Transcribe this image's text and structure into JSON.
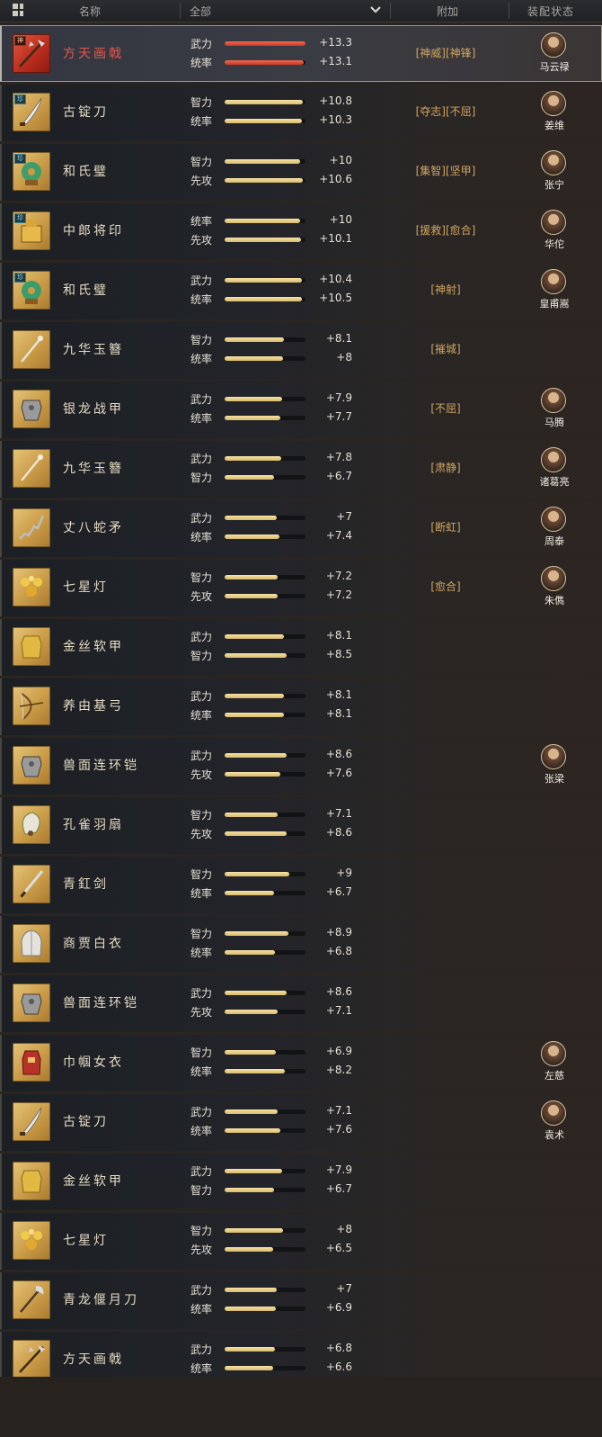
{
  "header": {
    "col_name": "名称",
    "filter_value": "全部",
    "col_extra": "附加",
    "col_status": "装配状态",
    "icons": [
      "grid-view-icon",
      "chevron-down-icon"
    ]
  },
  "colors": {
    "bar_fill": "#e6cb83",
    "bar_fill_selected": "#dc4a33",
    "tag_text": "#d2a560",
    "name_selected": "#e8574a"
  },
  "rows": [
    {
      "name": "方天画戟",
      "icon": "halberd-icon",
      "tier_badge": "神",
      "selected": true,
      "s1": {
        "label": "武力",
        "value": "+13.3",
        "fill": 1.0
      },
      "s2": {
        "label": "统率",
        "value": "+13.1",
        "fill": 0.98
      },
      "extra": "[神威][神锋]",
      "officer": "马云禄"
    },
    {
      "name": "古锭刀",
      "icon": "blade-icon",
      "tier_badge": "珍",
      "s1": {
        "label": "智力",
        "value": "+10.8",
        "fill": 0.97
      },
      "s2": {
        "label": "统率",
        "value": "+10.3",
        "fill": 0.96
      },
      "extra": "[夺志][不屈]",
      "officer": "姜维"
    },
    {
      "name": "和氏璧",
      "icon": "jade-disc-icon",
      "tier_badge": "珍",
      "s1": {
        "label": "智力",
        "value": "+10",
        "fill": 0.93
      },
      "s2": {
        "label": "先攻",
        "value": "+10.6",
        "fill": 0.97
      },
      "extra": "[集智][坚甲]",
      "officer": "张宁"
    },
    {
      "name": "中郎将印",
      "icon": "seal-icon",
      "tier_badge": "珍",
      "s1": {
        "label": "统率",
        "value": "+10",
        "fill": 0.93
      },
      "s2": {
        "label": "先攻",
        "value": "+10.1",
        "fill": 0.94
      },
      "extra": "[援救][愈合]",
      "officer": "华佗"
    },
    {
      "name": "和氏璧",
      "icon": "jade-disc-icon",
      "tier_badge": "珍",
      "s1": {
        "label": "武力",
        "value": "+10.4",
        "fill": 0.95
      },
      "s2": {
        "label": "统率",
        "value": "+10.5",
        "fill": 0.96
      },
      "extra": "[神射]",
      "officer": "皇甫嵩"
    },
    {
      "name": "九华玉簪",
      "icon": "hairpin-icon",
      "s1": {
        "label": "智力",
        "value": "+8.1",
        "fill": 0.73
      },
      "s2": {
        "label": "统率",
        "value": "+8",
        "fill": 0.72
      },
      "extra": "[摧城]",
      "officer": ""
    },
    {
      "name": "银龙战甲",
      "icon": "armor-icon",
      "s1": {
        "label": "武力",
        "value": "+7.9",
        "fill": 0.71
      },
      "s2": {
        "label": "统率",
        "value": "+7.7",
        "fill": 0.69
      },
      "extra": "[不屈]",
      "officer": "马腾"
    },
    {
      "name": "九华玉簪",
      "icon": "hairpin-icon",
      "s1": {
        "label": "武力",
        "value": "+7.8",
        "fill": 0.7
      },
      "s2": {
        "label": "智力",
        "value": "+6.7",
        "fill": 0.61
      },
      "extra": "[肃静]",
      "officer": "诸葛亮"
    },
    {
      "name": "丈八蛇矛",
      "icon": "spear-icon",
      "s1": {
        "label": "武力",
        "value": "+7",
        "fill": 0.64
      },
      "s2": {
        "label": "统率",
        "value": "+7.4",
        "fill": 0.68
      },
      "extra": "[断虹]",
      "officer": "周泰"
    },
    {
      "name": "七星灯",
      "icon": "lamp-icon",
      "s1": {
        "label": "智力",
        "value": "+7.2",
        "fill": 0.66
      },
      "s2": {
        "label": "先攻",
        "value": "+7.2",
        "fill": 0.66
      },
      "extra": "[愈合]",
      "officer": "朱儁"
    },
    {
      "name": "金丝软甲",
      "icon": "vest-icon",
      "s1": {
        "label": "武力",
        "value": "+8.1",
        "fill": 0.73
      },
      "s2": {
        "label": "智力",
        "value": "+8.5",
        "fill": 0.77
      },
      "extra": "",
      "officer": ""
    },
    {
      "name": "养由基弓",
      "icon": "bow-icon",
      "s1": {
        "label": "武力",
        "value": "+8.1",
        "fill": 0.73
      },
      "s2": {
        "label": "统率",
        "value": "+8.1",
        "fill": 0.73
      },
      "extra": "",
      "officer": ""
    },
    {
      "name": "兽面连环铠",
      "icon": "armor-icon",
      "s1": {
        "label": "武力",
        "value": "+8.6",
        "fill": 0.77
      },
      "s2": {
        "label": "先攻",
        "value": "+7.6",
        "fill": 0.69
      },
      "extra": "",
      "officer": "张梁"
    },
    {
      "name": "孔雀羽扇",
      "icon": "fan-icon",
      "s1": {
        "label": "智力",
        "value": "+7.1",
        "fill": 0.65
      },
      "s2": {
        "label": "先攻",
        "value": "+8.6",
        "fill": 0.77
      },
      "extra": "",
      "officer": ""
    },
    {
      "name": "青釭剑",
      "icon": "sword-icon",
      "s1": {
        "label": "智力",
        "value": "+9",
        "fill": 0.8
      },
      "s2": {
        "label": "统率",
        "value": "+6.7",
        "fill": 0.61
      },
      "extra": "",
      "officer": ""
    },
    {
      "name": "商贾白衣",
      "icon": "robe-icon",
      "s1": {
        "label": "智力",
        "value": "+8.9",
        "fill": 0.79
      },
      "s2": {
        "label": "统率",
        "value": "+6.8",
        "fill": 0.62
      },
      "extra": "",
      "officer": ""
    },
    {
      "name": "兽面连环铠",
      "icon": "armor-icon",
      "s1": {
        "label": "武力",
        "value": "+8.6",
        "fill": 0.77
      },
      "s2": {
        "label": "先攻",
        "value": "+7.1",
        "fill": 0.65
      },
      "extra": "",
      "officer": ""
    },
    {
      "name": "巾帼女衣",
      "icon": "dress-icon",
      "s1": {
        "label": "智力",
        "value": "+6.9",
        "fill": 0.63
      },
      "s2": {
        "label": "统率",
        "value": "+8.2",
        "fill": 0.74
      },
      "extra": "",
      "officer": "左慈"
    },
    {
      "name": "古锭刀",
      "icon": "blade-icon",
      "s1": {
        "label": "武力",
        "value": "+7.1",
        "fill": 0.65
      },
      "s2": {
        "label": "统率",
        "value": "+7.6",
        "fill": 0.69
      },
      "extra": "",
      "officer": "袁术"
    },
    {
      "name": "金丝软甲",
      "icon": "vest-icon",
      "s1": {
        "label": "武力",
        "value": "+7.9",
        "fill": 0.71
      },
      "s2": {
        "label": "智力",
        "value": "+6.7",
        "fill": 0.61
      },
      "extra": "",
      "officer": ""
    },
    {
      "name": "七星灯",
      "icon": "lamp-icon",
      "s1": {
        "label": "智力",
        "value": "+8",
        "fill": 0.72
      },
      "s2": {
        "label": "先攻",
        "value": "+6.5",
        "fill": 0.6
      },
      "extra": "",
      "officer": ""
    },
    {
      "name": "青龙偃月刀",
      "icon": "glaive-icon",
      "s1": {
        "label": "武力",
        "value": "+7",
        "fill": 0.64
      },
      "s2": {
        "label": "统率",
        "value": "+6.9",
        "fill": 0.63
      },
      "extra": "",
      "officer": ""
    },
    {
      "name": "方天画戟",
      "icon": "halberd-icon",
      "s1": {
        "label": "武力",
        "value": "+6.8",
        "fill": 0.62
      },
      "s2": {
        "label": "统率",
        "value": "+6.6",
        "fill": 0.6
      },
      "extra": "",
      "officer": ""
    }
  ]
}
